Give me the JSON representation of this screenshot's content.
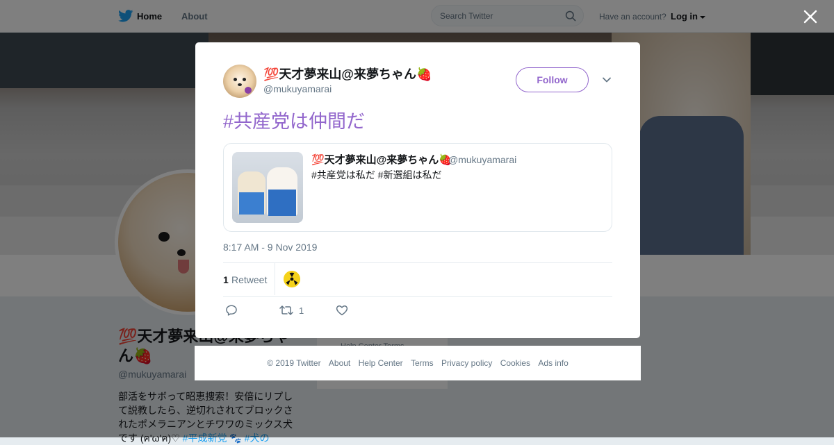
{
  "nav": {
    "home": "Home",
    "about": "About",
    "search_placeholder": "Search Twitter",
    "have_account": "Have an account?",
    "login": "Log in"
  },
  "profile": {
    "name": "💯天才夢来山@来夢ちゃん🍓",
    "handle": "@mukuyamarai",
    "bio_text": "部活をサボって昭恵捜索！安倍にリプして説教したら、逆切れされてブロックされたポメラニアンとチワワのミックス犬です (ฅ'ω'ฅ)♡ ",
    "bio_tag": "#平成新党 🐾 #犬の",
    "side_card_text": "Help Center   Terms"
  },
  "tweet": {
    "author_name": "💯天才夢来山@来夢ちゃん🍓",
    "author_handle": "@mukuyamarai",
    "follow_label": "Follow",
    "text": "#共産党は仲間だ",
    "quoted": {
      "author_name": "💯天才夢来山@来夢ちゃん🍓",
      "author_handle": "@mukuyamarai",
      "text": "#共産党は私だ  #新選組は私だ"
    },
    "timestamp": "8:17 AM - 9 Nov 2019",
    "retweet_count": "1",
    "retweet_label": "Retweet",
    "action_retweet_count": "1"
  },
  "footer": {
    "links": [
      "© 2019 Twitter",
      "About",
      "Help Center",
      "Terms",
      "Privacy policy",
      "Cookies",
      "Ads info"
    ]
  },
  "colors": {
    "accent": "#9266cc",
    "twitter_blue": "#1da1f2",
    "muted": "#657786",
    "text": "#14171a"
  },
  "icons": [
    "twitter-bird-icon",
    "search-icon",
    "close-icon",
    "chevron-down-icon",
    "reply-icon",
    "retweet-icon",
    "like-icon"
  ]
}
